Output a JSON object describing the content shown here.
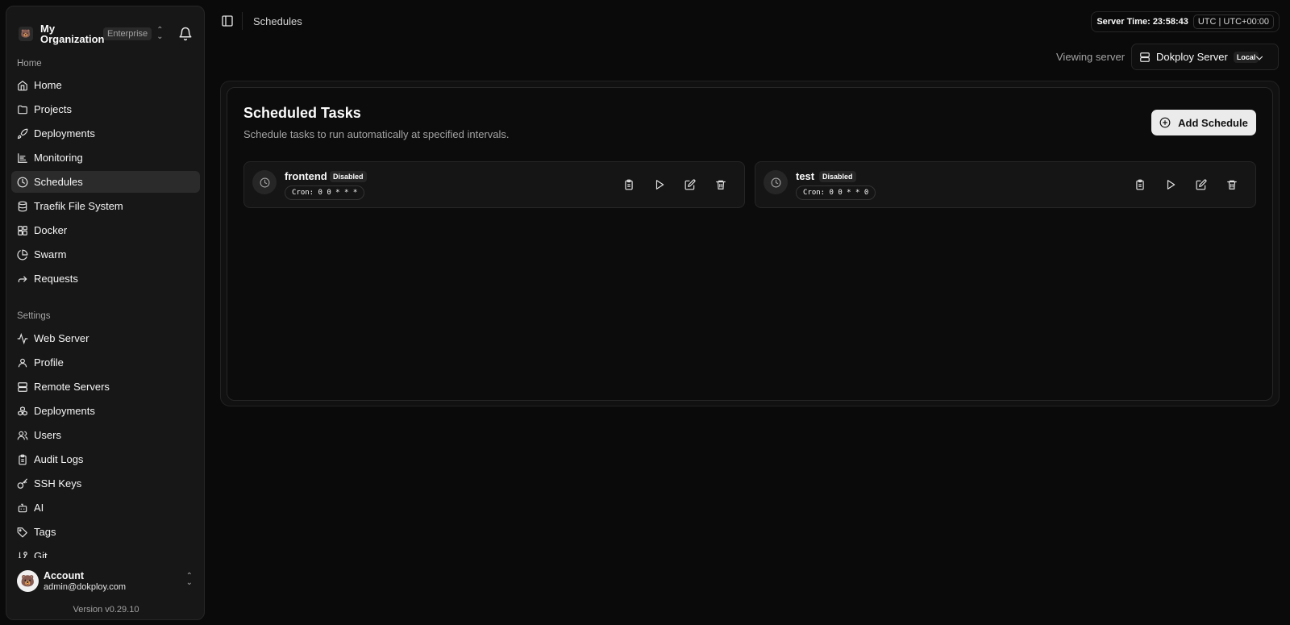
{
  "org": {
    "name": "My Organization",
    "plan": "Enterprise",
    "logo": "bear-logo"
  },
  "sidebar": {
    "home_label": "Home",
    "home_items": [
      {
        "label": "Home",
        "icon": "home-icon"
      },
      {
        "label": "Projects",
        "icon": "folder-icon"
      },
      {
        "label": "Deployments",
        "icon": "rocket-icon"
      },
      {
        "label": "Monitoring",
        "icon": "chart-icon"
      },
      {
        "label": "Schedules",
        "icon": "clock-icon",
        "active": true
      },
      {
        "label": "Traefik File System",
        "icon": "database-icon"
      },
      {
        "label": "Docker",
        "icon": "blocks-icon"
      },
      {
        "label": "Swarm",
        "icon": "pie-icon"
      },
      {
        "label": "Requests",
        "icon": "forward-icon"
      }
    ],
    "settings_label": "Settings",
    "settings_items": [
      {
        "label": "Web Server",
        "icon": "activity-icon"
      },
      {
        "label": "Profile",
        "icon": "user-icon"
      },
      {
        "label": "Remote Servers",
        "icon": "server-icon"
      },
      {
        "label": "Deployments",
        "icon": "boxes-icon"
      },
      {
        "label": "Users",
        "icon": "users-icon"
      },
      {
        "label": "Audit Logs",
        "icon": "clipboard-icon"
      },
      {
        "label": "SSH Keys",
        "icon": "key-icon"
      },
      {
        "label": "AI",
        "icon": "bot-icon"
      },
      {
        "label": "Tags",
        "icon": "tags-icon"
      },
      {
        "label": "Git",
        "icon": "git-icon"
      }
    ]
  },
  "account": {
    "name": "Account",
    "email": "admin@dokploy.com"
  },
  "version": "Version v0.29.10",
  "header": {
    "breadcrumb": "Schedules",
    "server_time_label": "Server Time: 23:58:43",
    "timezone": "UTC | UTC+00:00",
    "viewing_label": "Viewing server",
    "server_name": "Dokploy Server",
    "server_badge": "Local"
  },
  "main": {
    "title": "Scheduled Tasks",
    "subtitle": "Schedule tasks to run automatically at specified intervals.",
    "add_label": "Add Schedule",
    "tasks": [
      {
        "name": "frontend",
        "status": "Disabled",
        "cron": "Cron: 0 0 * * *"
      },
      {
        "name": "test",
        "status": "Disabled",
        "cron": "Cron: 0 0 * * 0"
      }
    ]
  },
  "colors": {
    "background": "#0a0a0a",
    "sidebar": "#171717",
    "accent_button": "#ebebeb"
  }
}
